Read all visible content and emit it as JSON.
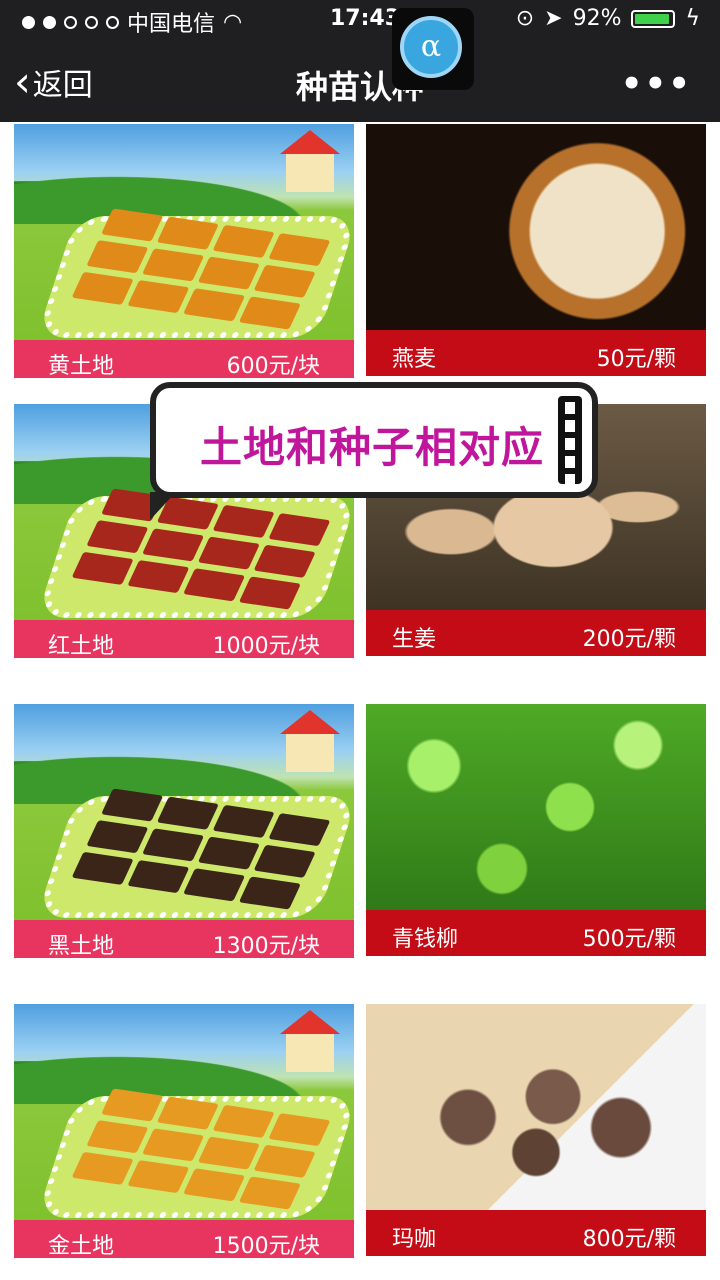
{
  "status_bar": {
    "carrier": "中国电信",
    "time": "17:43",
    "battery_percent": "92%",
    "signal_bars_filled": 2,
    "signal_bars_total": 5,
    "battery_level": 0.92
  },
  "nav": {
    "back_label": "返回",
    "title": "种苗认种",
    "more": "•••"
  },
  "overlay": {
    "badge_symbol": "α",
    "bubble_text": "土地和种子相对应"
  },
  "lands": [
    {
      "name": "黄土地",
      "price": "600元/块",
      "plot_color": "#e08a1a"
    },
    {
      "name": "红土地",
      "price": "1000元/块",
      "plot_color": "#a8271c"
    },
    {
      "name": "黑土地",
      "price": "1300元/块",
      "plot_color": "#3b2518"
    },
    {
      "name": "金土地",
      "price": "1500元/块",
      "plot_color": "#e69a22"
    }
  ],
  "seeds": [
    {
      "name": "燕麦",
      "price": "50元/颗",
      "image": "oats"
    },
    {
      "name": "生姜",
      "price": "200元/颗",
      "image": "ginger"
    },
    {
      "name": "青钱柳",
      "price": "500元/颗",
      "image": "willow"
    },
    {
      "name": "玛咖",
      "price": "800元/颗",
      "image": "maca"
    }
  ],
  "colors": {
    "land_caption": "#e83560",
    "seed_caption": "#c30c16",
    "bubble_text": "#c0169c",
    "topbar": "#1f1f22"
  }
}
